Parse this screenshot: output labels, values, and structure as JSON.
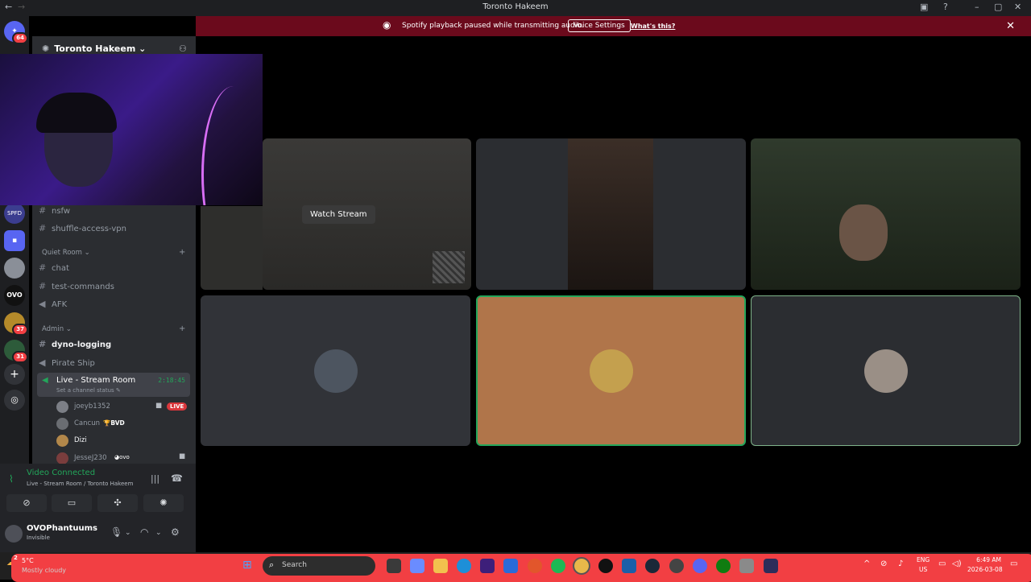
{
  "window": {
    "title": "Toronto Hakeem"
  },
  "banner": {
    "message": "Spotify playback paused while transmitting audio.",
    "voice_settings": "Voice Settings",
    "whats_this": "What's this?"
  },
  "guild_badges": {
    "dm": "64",
    "g1": "37",
    "g2": "31"
  },
  "server": {
    "name": "Toronto Hakeem"
  },
  "channels": {
    "nsfw": "nsfw",
    "vpn": "shuffle-access-vpn",
    "cat_quiet": "Quiet Room",
    "chat": "chat",
    "test": "test-commands",
    "afk": "AFK",
    "cat_admin": "Admin",
    "dyno": "dyno-logging",
    "pirate": "Pirate Ship",
    "live_room": "Live - Stream Room",
    "live_time": "2:18:45",
    "live_status": "Set a channel status"
  },
  "voice_users": [
    {
      "name": "joeyb1352",
      "live": "LIVE"
    },
    {
      "name": "Cancun",
      "tag": "BVD"
    },
    {
      "name": "Dizi"
    },
    {
      "name": "JesseJ230",
      "tag": "ovo"
    }
  ],
  "voice_panel": {
    "status": "Video Connected",
    "location": "Live - Stream Room / Toronto Hakeem"
  },
  "account": {
    "name": "OVOPhantuums",
    "status": "Invisible"
  },
  "stream": {
    "watch_label": "Watch Stream"
  },
  "taskbar": {
    "weather_temp": "5°C",
    "weather_desc": "Mostly cloudy",
    "weather_badge": "2",
    "search": "Search",
    "lang1": "ENG",
    "lang2": "US",
    "time": "6:49 AM",
    "date": "2026-03-08"
  },
  "colors": {
    "banner": "#6b0a1c",
    "accent_green": "#23a55a",
    "live_red": "#da373c",
    "orange_tile": "#b0754a"
  }
}
